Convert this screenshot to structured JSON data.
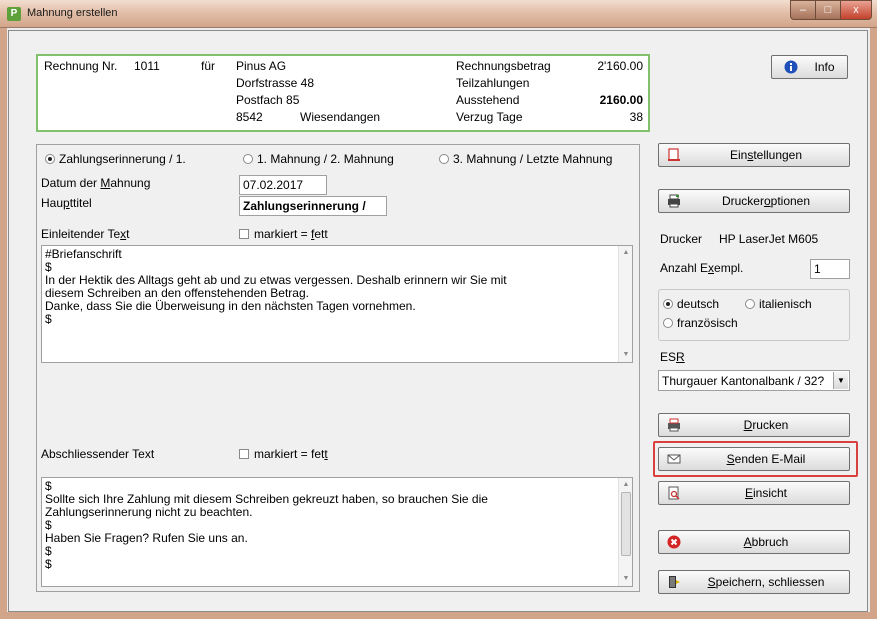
{
  "window": {
    "title": "Mahnung erstellen",
    "app_icon_glyph": "P"
  },
  "titlebar_buttons": {
    "minimize": "–",
    "maximize": "□",
    "close": "x"
  },
  "invoice": {
    "rechnung_label": "Rechnung Nr.",
    "rechnung_nr": "1011",
    "fuer_label": "für",
    "customer": [
      "Pinus AG",
      "Dorfstrasse 48",
      "Postfach 85"
    ],
    "plz": "8542",
    "ort": "Wiesendangen",
    "amount_labels": [
      "Rechnungsbetrag",
      "Teilzahlungen",
      "Ausstehend",
      "Verzug Tage"
    ],
    "amounts": [
      "2'160.00",
      "",
      "2160.00",
      "38"
    ]
  },
  "buttons": {
    "info": "Info",
    "einstellungen_pre": "Ein",
    "einstellungen_u": "s",
    "einstellungen_post": "tellungen",
    "druckeroptionen_pre": "Drucker",
    "druckeroptionen_u": "o",
    "druckeroptionen_post": "ptionen",
    "drucken_u": "D",
    "drucken_post": "rucken",
    "senden_u": "S",
    "senden_post": "enden E-Mail",
    "einsicht_u": "E",
    "einsicht_post": "insicht",
    "abbruch_u": "A",
    "abbruch_post": "bbruch",
    "speichern_u": "S",
    "speichern_post": "peichern, schliessen"
  },
  "level_options": [
    "Zahlungserinnerung / 1.",
    "1. Mahnung / 2. Mahnung",
    "3. Mahnung / Letzte Mahnung"
  ],
  "selected_level": 0,
  "form": {
    "datum_label_pre": "Datum der ",
    "datum_label_u": "M",
    "datum_label_post": "ahnung",
    "datum_value": "07.02.2017",
    "haupttitel_pre": "Hau",
    "haupttitel_u": "p",
    "haupttitel_post": "ttitel",
    "haupttitel_value": "Zahlungserinnerung /",
    "einleitend_pre": "Einleitender Te",
    "einleitend_u": "x",
    "einleitend_post": "t",
    "markiert_pre": "markiert = ",
    "markiert_u": "f",
    "markiert_post": "ett",
    "markiert2_pre": "markiert = fet",
    "markiert2_u": "t",
    "einleitend_text": [
      "#Briefanschrift",
      "$",
      "In der Hektik des Alltags geht ab und zu etwas vergessen. Deshalb erinnern wir Sie mit",
      "diesem Schreiben an den offenstehenden Betrag.",
      "Danke, dass Sie die Überweisung in den nächsten Tagen vornehmen.",
      "$"
    ],
    "abschliessend_label": "Abschliessender Text",
    "abschliessend_text": [
      "$",
      "Sollte sich Ihre Zahlung mit diesem Schreiben gekreuzt haben, so brauchen Sie die",
      "Zahlungserinnerung nicht zu beachten.",
      "$",
      "Haben Sie Fragen? Rufen Sie uns an.",
      "$",
      "$"
    ]
  },
  "printer": {
    "drucker_label": "Drucker",
    "drucker_value": "HP LaserJet M605",
    "anzahl_pre": "Anzahl E",
    "anzahl_u": "x",
    "anzahl_post": "empl.",
    "anzahl_value": "1",
    "languages": [
      "deutsch",
      "italienisch",
      "französisch"
    ],
    "selected_language": 0,
    "esr_pre": "ES",
    "esr_u": "R",
    "esr_value": "Thurgauer Kantonalbank / 32?"
  },
  "colors": {
    "accent_green_border": "#7fc26b",
    "highlight_red": "#d9413e"
  }
}
